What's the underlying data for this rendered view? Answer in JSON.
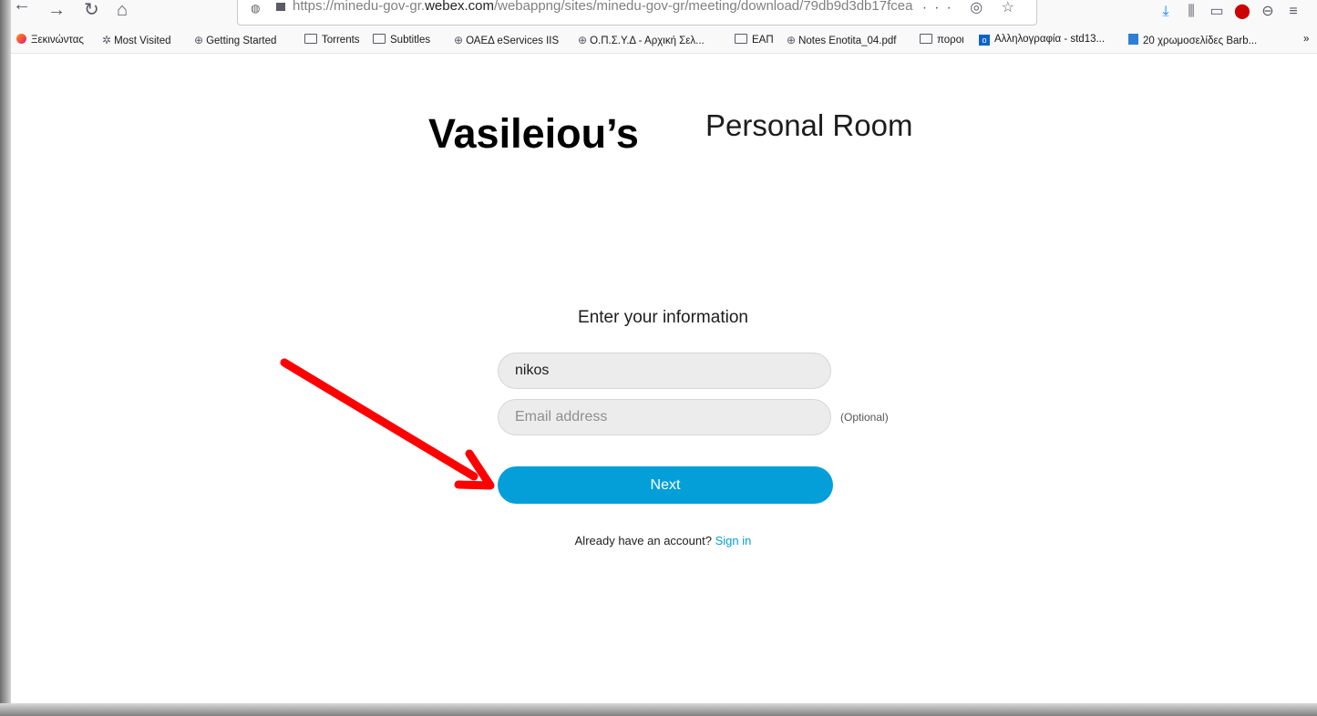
{
  "browser": {
    "url_prefix": "https://minedu-gov-gr.",
    "url_domain": "webex.com",
    "url_suffix": "/webappng/sites/minedu-gov-gr/meeting/download/79db9d3db17fcea",
    "bookmarks": [
      {
        "label": "Ξεκινώντας",
        "icon": "firefox-icon"
      },
      {
        "label": "Most Visited",
        "icon": "gear-icon"
      },
      {
        "label": "Getting Started",
        "icon": "globe-icon"
      },
      {
        "label": "Torrents",
        "icon": "folder-icon"
      },
      {
        "label": "Subtitles",
        "icon": "folder-icon"
      },
      {
        "label": "ΟΑΕΔ eServices IIS",
        "icon": "globe-icon"
      },
      {
        "label": "Ο.Π.Σ.Υ.Δ - Αρχική Σελ...",
        "icon": "globe-icon"
      },
      {
        "label": "ΕΑΠ",
        "icon": "folder-icon"
      },
      {
        "label": "Notes Enotita_04.pdf",
        "icon": "globe-icon"
      },
      {
        "label": "ποροι",
        "icon": "folder-icon"
      },
      {
        "label": "Αλληλογραφία - std13...",
        "icon": "outlook-icon"
      },
      {
        "label": "20 χρωμοσελίδες Barb...",
        "icon": "document-icon"
      }
    ]
  },
  "page": {
    "owner_name": "Vasileiou’s",
    "room_suffix": "Personal Room",
    "form_heading": "Enter your information",
    "name_value": "nikos",
    "email_placeholder": "Email address",
    "optional_label": "(Optional)",
    "next_label": "Next",
    "account_prompt": "Already have an account?",
    "sign_in_label": "Sign in"
  },
  "colors": {
    "accent": "#049fd9",
    "arrow": "#ff0000"
  }
}
